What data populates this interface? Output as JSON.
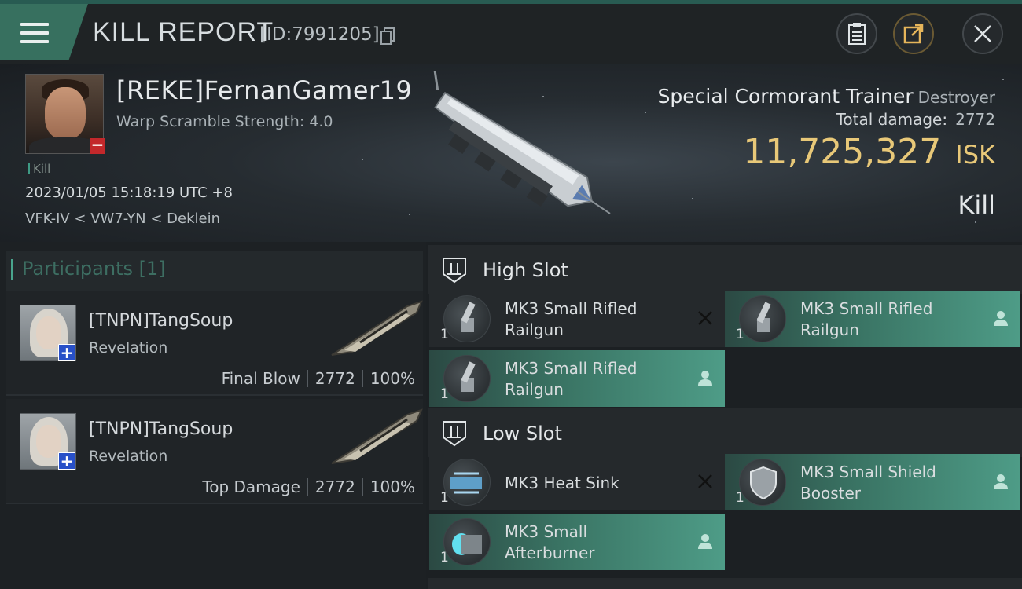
{
  "header": {
    "title": "KILL REPORT",
    "kill_id": "[ID:7991205]"
  },
  "victim": {
    "name": "[REKE]FernanGamer19",
    "warp_scramble": "Warp Scramble Strength: 4.0",
    "tag": "Kill",
    "datetime": "2023/01/05 15:18:19 UTC +8",
    "location": "VFK-IV < VW7-YN < Deklein",
    "ship_name": "Special Cormorant Trainer",
    "ship_class": "Destroyer",
    "total_damage_label": "Total damage:",
    "total_damage": "2772",
    "isk_value": "11,725,327",
    "isk_unit": "ISK",
    "result": "Kill"
  },
  "participants": {
    "title": "Participants",
    "count": "[1]",
    "rows": [
      {
        "name": "[TNPN]TangSoup",
        "ship": "Revelation",
        "role": "Final Blow",
        "damage": "2772",
        "percent": "100%"
      },
      {
        "name": "[TNPN]TangSoup",
        "ship": "Revelation",
        "role": "Top Damage",
        "damage": "2772",
        "percent": "100%"
      }
    ]
  },
  "fitting": {
    "high_slot": {
      "title": "High Slot",
      "modules": [
        {
          "line1": "MK3 Small Rifled",
          "line2": "Railgun",
          "qty": "1",
          "status": "destroyed",
          "icon": "railgun-icon"
        },
        {
          "line1": "MK3 Small Rifled",
          "line2": "Railgun",
          "qty": "1",
          "status": "dropped",
          "icon": "railgun-icon"
        },
        {
          "line1": "MK3 Small Rifled",
          "line2": "Railgun",
          "qty": "1",
          "status": "dropped",
          "icon": "railgun-icon"
        }
      ]
    },
    "low_slot": {
      "title": "Low Slot",
      "modules": [
        {
          "line1": "MK3 Heat Sink",
          "line2": "",
          "qty": "1",
          "status": "destroyed",
          "icon": "heat-sink-icon"
        },
        {
          "line1": "MK3 Small Shield",
          "line2": "Booster",
          "qty": "1",
          "status": "dropped",
          "icon": "shield-booster-icon"
        },
        {
          "line1": "MK3 Small",
          "line2": "Afterburner",
          "qty": "1",
          "status": "dropped",
          "icon": "afterburner-icon"
        }
      ]
    }
  },
  "colors": {
    "accent": "#37705f",
    "isk": "#e8c878",
    "fitted_module": "#3a7464",
    "destroyed_badge": "#c3282b",
    "friendly_badge": "#2850c8"
  }
}
